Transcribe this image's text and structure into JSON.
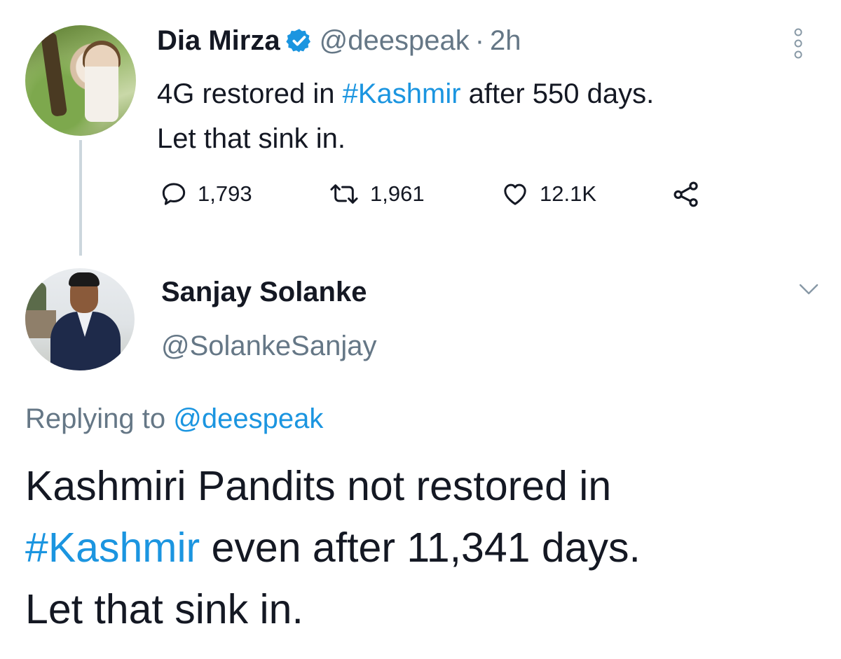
{
  "parent_tweet": {
    "display_name": "Dia Mirza",
    "handle": "@deespeak",
    "separator": "·",
    "time": "2h",
    "text": {
      "before_tag": "4G restored in ",
      "hashtag": "#Kashmir",
      "after_tag": " after 550 days.",
      "line2": "Let that sink in."
    },
    "actions": {
      "replies": "1,793",
      "retweets": "1,961",
      "likes": "12.1K"
    }
  },
  "reply_tweet": {
    "display_name": "Sanjay Solanke",
    "handle": "@SolankeSanjay",
    "replying_prefix": "Replying to",
    "replying_handle": "@deespeak",
    "text": {
      "line1": "Kashmiri Pandits not restored in",
      "hashtag": "#Kashmir",
      "after_tag": " even after 11,341 days.",
      "line3": "Let that sink in."
    }
  },
  "colors": {
    "link": "#1b95e0",
    "muted": "#657786",
    "text": "#141823",
    "thread_line": "#ccd6dd"
  },
  "icons": [
    "verified-badge-icon",
    "more-options-icon",
    "reply-icon",
    "retweet-icon",
    "like-icon",
    "share-icon",
    "chevron-down-icon"
  ]
}
